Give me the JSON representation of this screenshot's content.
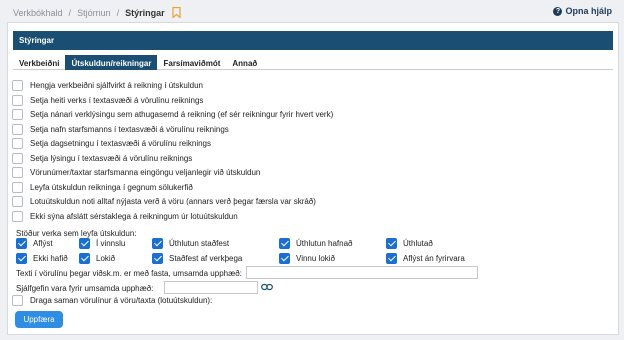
{
  "breadcrumb": {
    "items": [
      "Verkbókhald",
      "Stjórnun"
    ],
    "current": "Stýringar"
  },
  "help": {
    "label": "Opna hjálp"
  },
  "panel": {
    "title": "Stýringar"
  },
  "tabs": [
    {
      "label": "Verkbeiðni",
      "active": false
    },
    {
      "label": "Útskuldun/reikningar",
      "active": true
    },
    {
      "label": "Farsímaviðmót",
      "active": false
    },
    {
      "label": "Annað",
      "active": false
    }
  ],
  "options": [
    {
      "label": "Hengja verkbeiðni sjálfvirkt á reikning í útskuldun",
      "checked": false
    },
    {
      "label": "Setja heiti verks í textasvæði á vörulínu reiknings",
      "checked": false
    },
    {
      "label": "Setja nánari verklýsingu sem athugasemd á reikning (ef sér reikningur fyrir hvert verk)",
      "checked": false
    },
    {
      "label": "Setja nafn starfsmanns í textasvæði á vörulínu reiknings",
      "checked": false
    },
    {
      "label": "Setja dagsetningu í textasvæði á vörulínu reiknings",
      "checked": false
    },
    {
      "label": "Setja lýsingu í textasvæði á vörulínu reiknings",
      "checked": false
    },
    {
      "label": "Vörunúmer/taxtar starfsmanna eingöngu veljanlegir við útskuldun",
      "checked": false
    },
    {
      "label": "Leyfa útskuldun reikninga í gegnum sölukerfið",
      "checked": false
    },
    {
      "label": "Lotuútskuldun noti alltaf nýjasta verð á vöru (annars verð þegar færsla var skráð)",
      "checked": false
    },
    {
      "label": "Ekki sýna afslátt sérstaklega á reikningum úr lotuútskuldun",
      "checked": false
    }
  ],
  "statuses": {
    "heading": "Stöður verka sem leyfa útskuldun:",
    "items": [
      {
        "label": "Aflýst",
        "checked": true
      },
      {
        "label": "Í vinnslu",
        "checked": true
      },
      {
        "label": "Úthlutun staðfest",
        "checked": true
      },
      {
        "label": "Úthlutun hafnað",
        "checked": true
      },
      {
        "label": "Úthlutað",
        "checked": true
      },
      {
        "label": "Ekki hafið",
        "checked": true
      },
      {
        "label": "Lokið",
        "checked": true
      },
      {
        "label": "Staðfest af verkþega",
        "checked": true
      },
      {
        "label": "Vinnu lokið",
        "checked": true
      },
      {
        "label": "Aflýst án fyrirvara",
        "checked": true
      }
    ]
  },
  "fields": {
    "fixed_text": {
      "label": "Texti í vörulínu þegar viðsk.m. er með fasta, umsamda upphæð:",
      "value": ""
    },
    "default_product": {
      "label": "Sjálfgefin vara fyrir umsamda upphæð:",
      "value": ""
    },
    "merge": {
      "label": "Draga saman vörulínur á vöru/taxta (lotuútskuldun):",
      "checked": false
    }
  },
  "update_button": {
    "label": "Uppfæra"
  },
  "colors": {
    "header": "#1a4f73",
    "checkbox": "#1a6fd0",
    "button": "#2f8de4",
    "bookmark": "#f0a030"
  }
}
